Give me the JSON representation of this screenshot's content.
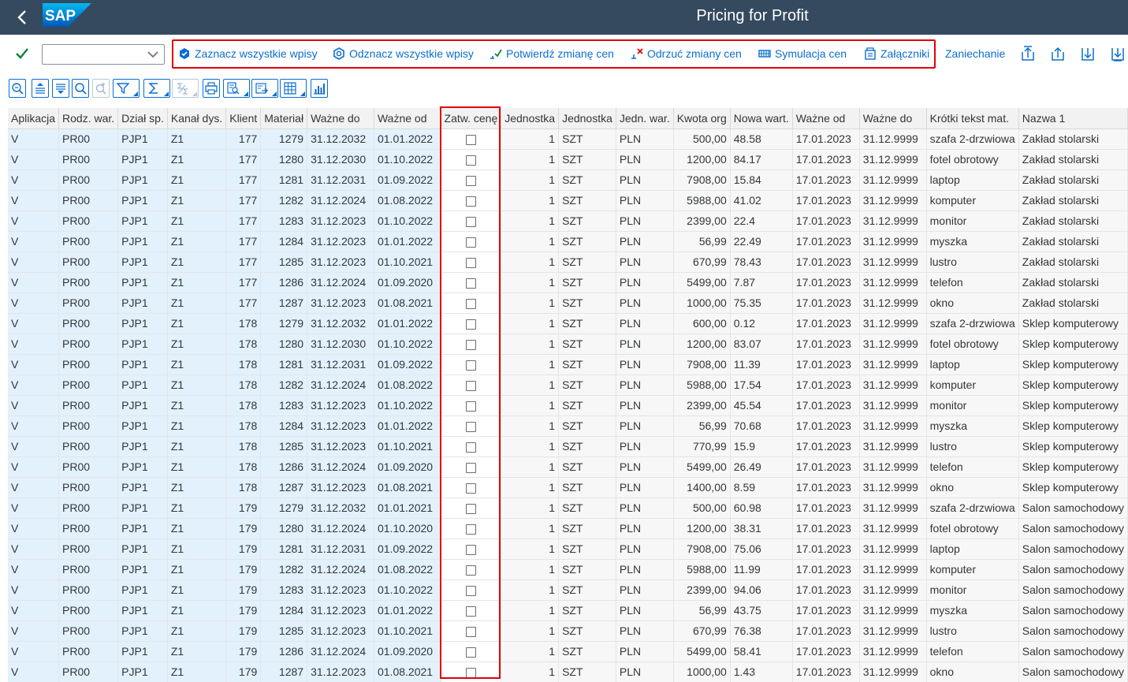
{
  "shell": {
    "title": "Pricing for Profit",
    "logo": "SAP"
  },
  "toolbar": {
    "select_value": "",
    "buttons": {
      "select_all": "Zaznacz wszystkie wpisy",
      "deselect_all": "Odznacz wszystkie wpisy",
      "confirm_price": "Potwierdź zmianę cen",
      "reject_price": "Odrzuć zmiany cen",
      "simulation": "Symulacja cen",
      "attachments": "Załączniki",
      "cancel": "Zaniechanie"
    }
  },
  "colors": {
    "shell_bg": "#354a5f",
    "link": "#0a6ed1",
    "highlight": "#e0000a",
    "key_cell": "#e3f1fc"
  },
  "table": {
    "headers": [
      "Aplikacja",
      "Rodz. war.",
      "Dział sp.",
      "Kanał dys.",
      "Klient",
      "Materiał",
      "Ważne do",
      "Ważne od",
      "Zatw. cenę",
      "Jednostka",
      "Jednostka",
      "Jedn. war.",
      "Kwota org",
      "Nowa wart.",
      "Ważne od",
      "Ważne do",
      "Krótki tekst mat.",
      "Nazwa 1"
    ],
    "rows": [
      [
        "V",
        "PR00",
        "PJP1",
        "Z1",
        "177",
        "1279",
        "31.12.2032",
        "01.01.2022",
        false,
        "1",
        "SZT",
        "PLN",
        "500,00",
        "48.58",
        "17.01.2023",
        "31.12.9999",
        "szafa 2-drzwiowa",
        "Zakład stolarski"
      ],
      [
        "V",
        "PR00",
        "PJP1",
        "Z1",
        "177",
        "1280",
        "31.12.2030",
        "01.10.2022",
        false,
        "1",
        "SZT",
        "PLN",
        "1200,00",
        "84.17",
        "17.01.2023",
        "31.12.9999",
        "fotel obrotowy",
        "Zakład stolarski"
      ],
      [
        "V",
        "PR00",
        "PJP1",
        "Z1",
        "177",
        "1281",
        "31.12.2031",
        "01.09.2022",
        false,
        "1",
        "SZT",
        "PLN",
        "7908,00",
        "15.84",
        "17.01.2023",
        "31.12.9999",
        "laptop",
        "Zakład stolarski"
      ],
      [
        "V",
        "PR00",
        "PJP1",
        "Z1",
        "177",
        "1282",
        "31.12.2024",
        "01.08.2022",
        false,
        "1",
        "SZT",
        "PLN",
        "5988,00",
        "41.02",
        "17.01.2023",
        "31.12.9999",
        "komputer",
        "Zakład stolarski"
      ],
      [
        "V",
        "PR00",
        "PJP1",
        "Z1",
        "177",
        "1283",
        "31.12.2023",
        "01.10.2022",
        false,
        "1",
        "SZT",
        "PLN",
        "2399,00",
        "22.4",
        "17.01.2023",
        "31.12.9999",
        "monitor",
        "Zakład stolarski"
      ],
      [
        "V",
        "PR00",
        "PJP1",
        "Z1",
        "177",
        "1284",
        "31.12.2023",
        "01.01.2022",
        false,
        "1",
        "SZT",
        "PLN",
        "56,99",
        "22.49",
        "17.01.2023",
        "31.12.9999",
        "myszka",
        "Zakład stolarski"
      ],
      [
        "V",
        "PR00",
        "PJP1",
        "Z1",
        "177",
        "1285",
        "31.12.2023",
        "01.10.2021",
        false,
        "1",
        "SZT",
        "PLN",
        "670,99",
        "78.43",
        "17.01.2023",
        "31.12.9999",
        "lustro",
        "Zakład stolarski"
      ],
      [
        "V",
        "PR00",
        "PJP1",
        "Z1",
        "177",
        "1286",
        "31.12.2024",
        "01.09.2020",
        false,
        "1",
        "SZT",
        "PLN",
        "5499,00",
        "7.87",
        "17.01.2023",
        "31.12.9999",
        "telefon",
        "Zakład stolarski"
      ],
      [
        "V",
        "PR00",
        "PJP1",
        "Z1",
        "177",
        "1287",
        "31.12.2023",
        "01.08.2021",
        false,
        "1",
        "SZT",
        "PLN",
        "1000,00",
        "75.35",
        "17.01.2023",
        "31.12.9999",
        "okno",
        "Zakład stolarski"
      ],
      [
        "V",
        "PR00",
        "PJP1",
        "Z1",
        "178",
        "1279",
        "31.12.2032",
        "01.01.2022",
        false,
        "1",
        "SZT",
        "PLN",
        "600,00",
        "0.12",
        "17.01.2023",
        "31.12.9999",
        "szafa 2-drzwiowa",
        "Sklep komputerowy"
      ],
      [
        "V",
        "PR00",
        "PJP1",
        "Z1",
        "178",
        "1280",
        "31.12.2030",
        "01.10.2022",
        false,
        "1",
        "SZT",
        "PLN",
        "1200,00",
        "83.07",
        "17.01.2023",
        "31.12.9999",
        "fotel obrotowy",
        "Sklep komputerowy"
      ],
      [
        "V",
        "PR00",
        "PJP1",
        "Z1",
        "178",
        "1281",
        "31.12.2031",
        "01.09.2022",
        false,
        "1",
        "SZT",
        "PLN",
        "7908,00",
        "11.39",
        "17.01.2023",
        "31.12.9999",
        "laptop",
        "Sklep komputerowy"
      ],
      [
        "V",
        "PR00",
        "PJP1",
        "Z1",
        "178",
        "1282",
        "31.12.2024",
        "01.08.2022",
        false,
        "1",
        "SZT",
        "PLN",
        "5988,00",
        "17.54",
        "17.01.2023",
        "31.12.9999",
        "komputer",
        "Sklep komputerowy"
      ],
      [
        "V",
        "PR00",
        "PJP1",
        "Z1",
        "178",
        "1283",
        "31.12.2023",
        "01.10.2022",
        false,
        "1",
        "SZT",
        "PLN",
        "2399,00",
        "45.54",
        "17.01.2023",
        "31.12.9999",
        "monitor",
        "Sklep komputerowy"
      ],
      [
        "V",
        "PR00",
        "PJP1",
        "Z1",
        "178",
        "1284",
        "31.12.2023",
        "01.01.2022",
        false,
        "1",
        "SZT",
        "PLN",
        "56,99",
        "70.68",
        "17.01.2023",
        "31.12.9999",
        "myszka",
        "Sklep komputerowy"
      ],
      [
        "V",
        "PR00",
        "PJP1",
        "Z1",
        "178",
        "1285",
        "31.12.2023",
        "01.10.2021",
        false,
        "1",
        "SZT",
        "PLN",
        "770,99",
        "15.9",
        "17.01.2023",
        "31.12.9999",
        "lustro",
        "Sklep komputerowy"
      ],
      [
        "V",
        "PR00",
        "PJP1",
        "Z1",
        "178",
        "1286",
        "31.12.2024",
        "01.09.2020",
        false,
        "1",
        "SZT",
        "PLN",
        "5499,00",
        "26.49",
        "17.01.2023",
        "31.12.9999",
        "telefon",
        "Sklep komputerowy"
      ],
      [
        "V",
        "PR00",
        "PJP1",
        "Z1",
        "178",
        "1287",
        "31.12.2023",
        "01.08.2021",
        false,
        "1",
        "SZT",
        "PLN",
        "1400,00",
        "8.59",
        "17.01.2023",
        "31.12.9999",
        "okno",
        "Sklep komputerowy"
      ],
      [
        "V",
        "PR00",
        "PJP1",
        "Z1",
        "179",
        "1279",
        "31.12.2032",
        "01.01.2021",
        false,
        "1",
        "SZT",
        "PLN",
        "500,00",
        "60.98",
        "17.01.2023",
        "31.12.9999",
        "szafa 2-drzwiowa",
        "Salon samochodowy"
      ],
      [
        "V",
        "PR00",
        "PJP1",
        "Z1",
        "179",
        "1280",
        "31.12.2024",
        "01.10.2020",
        false,
        "1",
        "SZT",
        "PLN",
        "1200,00",
        "38.31",
        "17.01.2023",
        "31.12.9999",
        "fotel obrotowy",
        "Salon samochodowy"
      ],
      [
        "V",
        "PR00",
        "PJP1",
        "Z1",
        "179",
        "1281",
        "31.12.2031",
        "01.09.2022",
        false,
        "1",
        "SZT",
        "PLN",
        "7908,00",
        "75.06",
        "17.01.2023",
        "31.12.9999",
        "laptop",
        "Salon samochodowy"
      ],
      [
        "V",
        "PR00",
        "PJP1",
        "Z1",
        "179",
        "1282",
        "31.12.2024",
        "01.08.2022",
        false,
        "1",
        "SZT",
        "PLN",
        "5988,00",
        "11.99",
        "17.01.2023",
        "31.12.9999",
        "komputer",
        "Salon samochodowy"
      ],
      [
        "V",
        "PR00",
        "PJP1",
        "Z1",
        "179",
        "1283",
        "31.12.2023",
        "01.10.2022",
        false,
        "1",
        "SZT",
        "PLN",
        "2399,00",
        "94.06",
        "17.01.2023",
        "31.12.9999",
        "monitor",
        "Salon samochodowy"
      ],
      [
        "V",
        "PR00",
        "PJP1",
        "Z1",
        "179",
        "1284",
        "31.12.2023",
        "01.01.2022",
        false,
        "1",
        "SZT",
        "PLN",
        "56,99",
        "43.75",
        "17.01.2023",
        "31.12.9999",
        "myszka",
        "Salon samochodowy"
      ],
      [
        "V",
        "PR00",
        "PJP1",
        "Z1",
        "179",
        "1285",
        "31.12.2023",
        "01.10.2021",
        false,
        "1",
        "SZT",
        "PLN",
        "670,99",
        "76.38",
        "17.01.2023",
        "31.12.9999",
        "lustro",
        "Salon samochodowy"
      ],
      [
        "V",
        "PR00",
        "PJP1",
        "Z1",
        "179",
        "1286",
        "31.12.2024",
        "01.09.2020",
        false,
        "1",
        "SZT",
        "PLN",
        "5499,00",
        "58.41",
        "17.01.2023",
        "31.12.9999",
        "telefon",
        "Salon samochodowy"
      ],
      [
        "V",
        "PR00",
        "PJP1",
        "Z1",
        "179",
        "1287",
        "31.12.2023",
        "01.08.2021",
        false,
        "1",
        "SZT",
        "PLN",
        "1000,00",
        "1.43",
        "17.01.2023",
        "31.12.9999",
        "okno",
        "Salon samochodowy"
      ]
    ]
  }
}
